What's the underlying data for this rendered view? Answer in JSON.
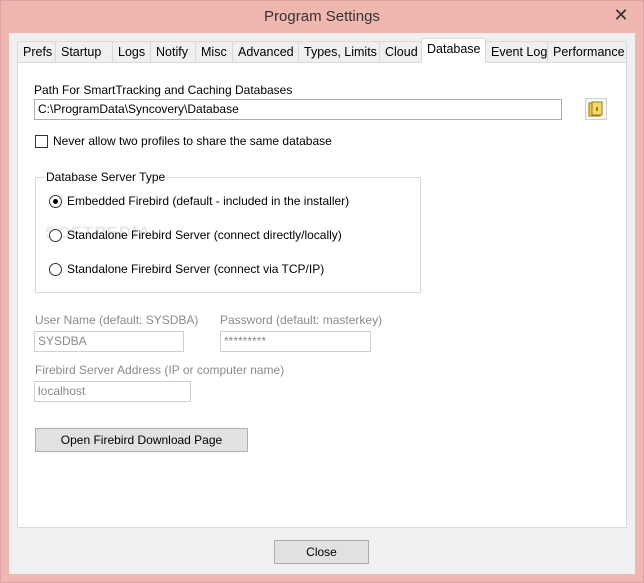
{
  "window": {
    "title": "Program Settings",
    "close_glyph": "✕"
  },
  "tabs": [
    {
      "label": "Prefs"
    },
    {
      "label": "Startup"
    },
    {
      "label": "Logs"
    },
    {
      "label": "Notify"
    },
    {
      "label": "Misc"
    },
    {
      "label": "Advanced"
    },
    {
      "label": "Types, Limits"
    },
    {
      "label": "Cloud"
    },
    {
      "label": "Database"
    },
    {
      "label": "Event Log"
    },
    {
      "label": "Performance"
    }
  ],
  "active_tab": "Database",
  "database": {
    "path_label": "Path For SmartTracking and Caching Databases",
    "path_value": "C:\\ProgramData\\Syncovery\\Database",
    "share_checkbox_label": "Never allow two profiles to share the same database",
    "share_checkbox_checked": false,
    "server_type_legend": "Database Server Type",
    "server_options": [
      {
        "label": "Embedded Firebird (default - included in the installer)",
        "selected": true
      },
      {
        "label": "Standalone Firebird Server (connect directly/locally)",
        "selected": false
      },
      {
        "label": "Standalone Firebird Server (connect via TCP/IP)",
        "selected": false
      }
    ],
    "username_label": "User Name (default: SYSDBA)",
    "username_value": "SYSDBA",
    "password_label": "Password (default: masterkey)",
    "password_value": "*********",
    "server_address_label": "Firebird Server Address  (IP or computer name)",
    "server_address_value": "localhost",
    "download_button": "Open Firebird Download Page"
  },
  "footer": {
    "close_button": "Close"
  },
  "watermark": "SOFTPEDIA",
  "icons": {
    "folder": "folder-icon"
  }
}
